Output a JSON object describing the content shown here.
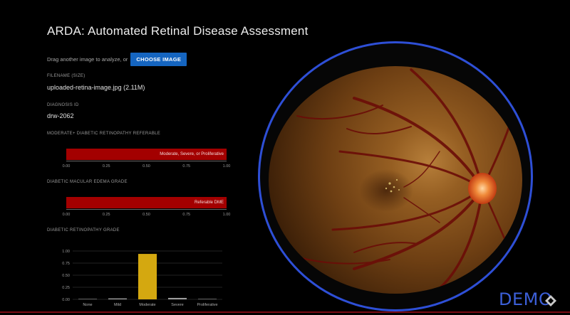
{
  "app": {
    "title": "ARDA: Automated Retinal Disease Assessment"
  },
  "upload": {
    "drag_text": "Drag another image to analyze, or",
    "choose_button": "CHOOSE IMAGE"
  },
  "file": {
    "label": "FILENAME (SIZE)",
    "value": "uploaded-retina-image.jpg (2.11M)"
  },
  "diagnosis": {
    "label": "DIAGNOSIS ID",
    "value": "drw-2062"
  },
  "dr_referable": {
    "label": "MODERATE+ DIABETIC RETINOPATHY REFERABLE",
    "bar_label": "Moderate, Severe, or Proliferative",
    "value": 1.0,
    "ticks": [
      "0.00",
      "0.25",
      "0.50",
      "0.75",
      "1.00"
    ]
  },
  "dme": {
    "label": "DIABETIC MACULAR EDEMA GRADE",
    "bar_label": "Referable DME",
    "value": 1.0,
    "ticks": [
      "0.00",
      "0.25",
      "0.50",
      "0.75",
      "1.00"
    ]
  },
  "dr_grade": {
    "label": "DIABETIC RETINOPATHY GRADE"
  },
  "chart_data": {
    "type": "bar",
    "categories": [
      "None",
      "Mild",
      "Moderate",
      "Severe",
      "Proliferative"
    ],
    "values": [
      0.0,
      0.02,
      0.94,
      0.03,
      0.0
    ],
    "yticks": [
      "0.00",
      "0.25",
      "0.50",
      "0.75",
      "1.00"
    ],
    "ylim": [
      0,
      1
    ],
    "bar_colors": [
      "#9e9e9e",
      "#9e9e9e",
      "#d4a810",
      "#9e9e9e",
      "#9e9e9e"
    ]
  },
  "watermark": {
    "text": "DEMO"
  },
  "colors": {
    "accent_blue": "#1565c0",
    "bar_red": "#a30000",
    "ring_blue": "#2e4fd6"
  }
}
